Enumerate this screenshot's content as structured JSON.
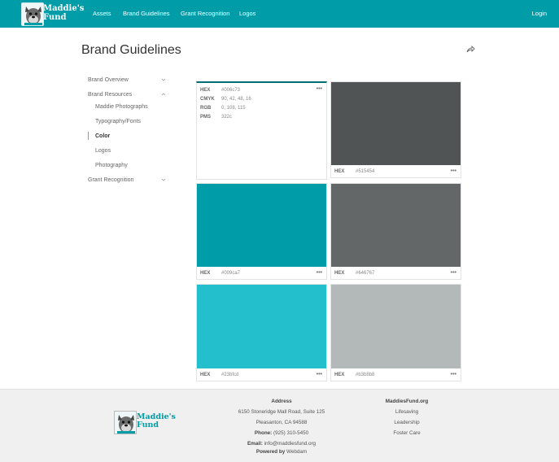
{
  "header": {
    "logo_text_line1": "Maddie's",
    "logo_text_line2": "Fund",
    "nav": [
      "Assets",
      "Brand Guidelines",
      "Grant Recognition",
      "Logos"
    ],
    "login_label": "Login",
    "bg_color": "#009ca7"
  },
  "page": {
    "title": "Brand Guidelines",
    "share_icon": "share-icon"
  },
  "sidebar": {
    "items": [
      {
        "label": "Brand Overview",
        "icon": "chevron-down-icon"
      },
      {
        "label": "Brand Resources",
        "icon": "chevron-up-icon"
      },
      {
        "label": "Maddie Photographs"
      },
      {
        "label": "Typography/Fonts"
      },
      {
        "label": "Color"
      },
      {
        "label": "Logos"
      },
      {
        "label": "Photography"
      },
      {
        "label": "Grant Recognition",
        "icon": "chevron-down-icon"
      }
    ],
    "active_item": "Color"
  },
  "colors": {
    "detail_card": {
      "rows": [
        {
          "key": "HEX",
          "value": "#006c73"
        },
        {
          "key": "CMYK",
          "value": "90, 42, 48, 16"
        },
        {
          "key": "RGB",
          "value": "0, 108, 115"
        },
        {
          "key": "PMS",
          "value": "322c"
        }
      ],
      "more": "•••",
      "accent": "#006c73"
    },
    "swatches": [
      {
        "label": "HEX",
        "value": "#515454",
        "color": "#515454",
        "more": "•••"
      },
      {
        "label": "HEX",
        "value": "#009ca7",
        "color": "#009ca7",
        "more": "•••"
      },
      {
        "label": "HEX",
        "value": "#646767",
        "color": "#646767",
        "more": "•••"
      },
      {
        "label": "HEX",
        "value": "#23bfcd",
        "color": "#23bfcd",
        "more": "•••"
      },
      {
        "label": "HEX",
        "value": "#b3b8b8",
        "color": "#b3b8b8",
        "more": "•••"
      }
    ]
  },
  "footer": {
    "logo_text_line1": "Maddie's",
    "logo_text_line2": "Fund",
    "address_heading": "Address",
    "address_line1": "6150 Stoneridge Mall Road, Suite 125",
    "address_line2": "Pleasanton, CA 94588",
    "phone_label": "Phone:",
    "phone_value": "(925) 310-5450",
    "email_label": "Email:",
    "email_value": "info@maddiesfund.org",
    "powered_label": "Powered by",
    "powered_value": "Webdam",
    "site_heading": "MaddiesFund.org",
    "links": [
      "Lifesaving",
      "Leadership",
      "Foster Care"
    ]
  }
}
